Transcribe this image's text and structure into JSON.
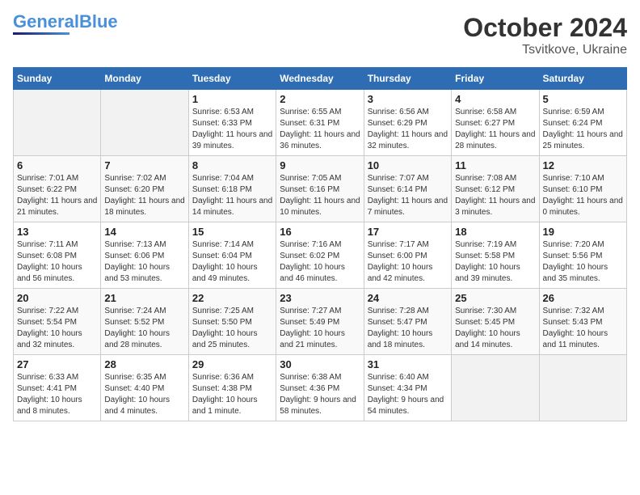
{
  "logo": {
    "part1": "General",
    "part2": "Blue"
  },
  "title": "October 2024",
  "subtitle": "Tsvitkove, Ukraine",
  "headers": [
    "Sunday",
    "Monday",
    "Tuesday",
    "Wednesday",
    "Thursday",
    "Friday",
    "Saturday"
  ],
  "weeks": [
    [
      {
        "day": "",
        "info": ""
      },
      {
        "day": "",
        "info": ""
      },
      {
        "day": "1",
        "info": "Sunrise: 6:53 AM\nSunset: 6:33 PM\nDaylight: 11 hours and 39 minutes."
      },
      {
        "day": "2",
        "info": "Sunrise: 6:55 AM\nSunset: 6:31 PM\nDaylight: 11 hours and 36 minutes."
      },
      {
        "day": "3",
        "info": "Sunrise: 6:56 AM\nSunset: 6:29 PM\nDaylight: 11 hours and 32 minutes."
      },
      {
        "day": "4",
        "info": "Sunrise: 6:58 AM\nSunset: 6:27 PM\nDaylight: 11 hours and 28 minutes."
      },
      {
        "day": "5",
        "info": "Sunrise: 6:59 AM\nSunset: 6:24 PM\nDaylight: 11 hours and 25 minutes."
      }
    ],
    [
      {
        "day": "6",
        "info": "Sunrise: 7:01 AM\nSunset: 6:22 PM\nDaylight: 11 hours and 21 minutes."
      },
      {
        "day": "7",
        "info": "Sunrise: 7:02 AM\nSunset: 6:20 PM\nDaylight: 11 hours and 18 minutes."
      },
      {
        "day": "8",
        "info": "Sunrise: 7:04 AM\nSunset: 6:18 PM\nDaylight: 11 hours and 14 minutes."
      },
      {
        "day": "9",
        "info": "Sunrise: 7:05 AM\nSunset: 6:16 PM\nDaylight: 11 hours and 10 minutes."
      },
      {
        "day": "10",
        "info": "Sunrise: 7:07 AM\nSunset: 6:14 PM\nDaylight: 11 hours and 7 minutes."
      },
      {
        "day": "11",
        "info": "Sunrise: 7:08 AM\nSunset: 6:12 PM\nDaylight: 11 hours and 3 minutes."
      },
      {
        "day": "12",
        "info": "Sunrise: 7:10 AM\nSunset: 6:10 PM\nDaylight: 11 hours and 0 minutes."
      }
    ],
    [
      {
        "day": "13",
        "info": "Sunrise: 7:11 AM\nSunset: 6:08 PM\nDaylight: 10 hours and 56 minutes."
      },
      {
        "day": "14",
        "info": "Sunrise: 7:13 AM\nSunset: 6:06 PM\nDaylight: 10 hours and 53 minutes."
      },
      {
        "day": "15",
        "info": "Sunrise: 7:14 AM\nSunset: 6:04 PM\nDaylight: 10 hours and 49 minutes."
      },
      {
        "day": "16",
        "info": "Sunrise: 7:16 AM\nSunset: 6:02 PM\nDaylight: 10 hours and 46 minutes."
      },
      {
        "day": "17",
        "info": "Sunrise: 7:17 AM\nSunset: 6:00 PM\nDaylight: 10 hours and 42 minutes."
      },
      {
        "day": "18",
        "info": "Sunrise: 7:19 AM\nSunset: 5:58 PM\nDaylight: 10 hours and 39 minutes."
      },
      {
        "day": "19",
        "info": "Sunrise: 7:20 AM\nSunset: 5:56 PM\nDaylight: 10 hours and 35 minutes."
      }
    ],
    [
      {
        "day": "20",
        "info": "Sunrise: 7:22 AM\nSunset: 5:54 PM\nDaylight: 10 hours and 32 minutes."
      },
      {
        "day": "21",
        "info": "Sunrise: 7:24 AM\nSunset: 5:52 PM\nDaylight: 10 hours and 28 minutes."
      },
      {
        "day": "22",
        "info": "Sunrise: 7:25 AM\nSunset: 5:50 PM\nDaylight: 10 hours and 25 minutes."
      },
      {
        "day": "23",
        "info": "Sunrise: 7:27 AM\nSunset: 5:49 PM\nDaylight: 10 hours and 21 minutes."
      },
      {
        "day": "24",
        "info": "Sunrise: 7:28 AM\nSunset: 5:47 PM\nDaylight: 10 hours and 18 minutes."
      },
      {
        "day": "25",
        "info": "Sunrise: 7:30 AM\nSunset: 5:45 PM\nDaylight: 10 hours and 14 minutes."
      },
      {
        "day": "26",
        "info": "Sunrise: 7:32 AM\nSunset: 5:43 PM\nDaylight: 10 hours and 11 minutes."
      }
    ],
    [
      {
        "day": "27",
        "info": "Sunrise: 6:33 AM\nSunset: 4:41 PM\nDaylight: 10 hours and 8 minutes."
      },
      {
        "day": "28",
        "info": "Sunrise: 6:35 AM\nSunset: 4:40 PM\nDaylight: 10 hours and 4 minutes."
      },
      {
        "day": "29",
        "info": "Sunrise: 6:36 AM\nSunset: 4:38 PM\nDaylight: 10 hours and 1 minute."
      },
      {
        "day": "30",
        "info": "Sunrise: 6:38 AM\nSunset: 4:36 PM\nDaylight: 9 hours and 58 minutes."
      },
      {
        "day": "31",
        "info": "Sunrise: 6:40 AM\nSunset: 4:34 PM\nDaylight: 9 hours and 54 minutes."
      },
      {
        "day": "",
        "info": ""
      },
      {
        "day": "",
        "info": ""
      }
    ]
  ]
}
